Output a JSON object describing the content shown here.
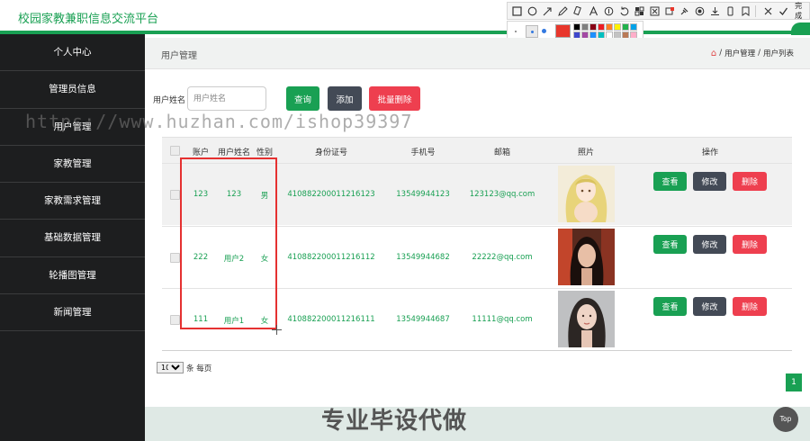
{
  "app": {
    "title": "校园家教兼职信息交流平台"
  },
  "annotation_toolbar": {
    "tools": [
      "rect-icon",
      "ellipse-icon",
      "arrow-icon",
      "pen-icon",
      "marker-icon",
      "text-icon",
      "number-icon",
      "undo-icon",
      "mosaic-icon",
      "translate-icon",
      "redo-icon",
      "pin-icon",
      "record-icon",
      "download-icon",
      "phone-icon",
      "bookmark-icon",
      "close-icon",
      "check-icon"
    ],
    "done_label": "完成",
    "active_color": "#e8372c",
    "palette": [
      "#000000",
      "#7f7f7f",
      "#880015",
      "#ed1c24",
      "#ff7f27",
      "#fff200",
      "#22b14c",
      "#00a2e8",
      "#3f48cc",
      "#a349a4",
      "#1e90ff",
      "#00c0c0",
      "#ffffff",
      "#c3c3c3",
      "#b97a57",
      "#ffaec9",
      "#ffc90e",
      "#efe4b0",
      "#b5e61d",
      "#99d9ea",
      "#7092be",
      "#c8bfe7",
      "#6a5acd",
      "#20b2aa"
    ]
  },
  "sidebar": {
    "items": [
      {
        "label": "个人中心"
      },
      {
        "label": "管理员信息"
      },
      {
        "label": "用户管理"
      },
      {
        "label": "家教管理"
      },
      {
        "label": "家教需求管理"
      },
      {
        "label": "基础数据管理"
      },
      {
        "label": "轮播图管理"
      },
      {
        "label": "新闻管理"
      }
    ]
  },
  "header": {
    "title": "用户管理",
    "breadcrumb": [
      "用户管理",
      "用户列表"
    ]
  },
  "search": {
    "label": "用户姓名",
    "placeholder": "用户姓名",
    "query_label": "查询",
    "add_label": "添加",
    "batch_delete_label": "批量删除"
  },
  "watermark": "https://www.huzhan.com/ishop39397",
  "table": {
    "columns": [
      "账户",
      "用户姓名",
      "性别",
      "身份证号",
      "手机号",
      "邮箱",
      "照片",
      "操作"
    ],
    "rows": [
      {
        "account": "123",
        "name": "123",
        "gender": "男",
        "id_card": "410882200011216123",
        "phone": "13549944123",
        "email": "123123@qq.com",
        "photo": "anime girl with blonde hair"
      },
      {
        "account": "222",
        "name": "用户2",
        "gender": "女",
        "id_card": "410882200011216112",
        "phone": "13549944682",
        "email": "22222@qq.com",
        "photo": "woman with dark hair, warm light"
      },
      {
        "account": "111",
        "name": "用户1",
        "gender": "女",
        "id_card": "410882200011216111",
        "phone": "13549944687",
        "email": "11111@qq.com",
        "photo": "woman with long dark hair, grey background"
      }
    ],
    "actions": {
      "view": "查看",
      "edit": "修改",
      "delete": "删除"
    }
  },
  "pagination": {
    "page_size": "10",
    "page_size_suffix": "条 每页",
    "current_page": "1"
  },
  "caption": "专业毕设代做",
  "top_button": "Top",
  "colors": {
    "accent": "#19a053",
    "danger": "#ee3f4f",
    "dark": "#434a56",
    "sidebar": "#1d1e1f"
  }
}
